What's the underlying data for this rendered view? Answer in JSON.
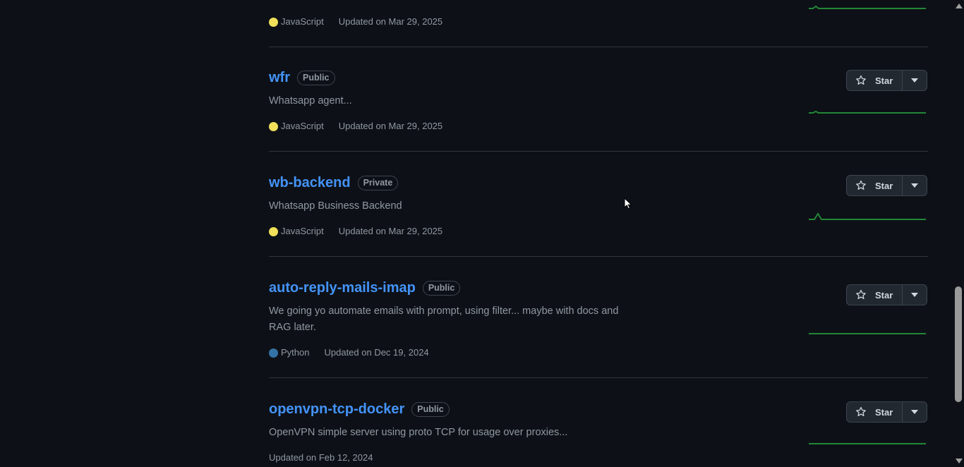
{
  "star_label": "Star",
  "repos": [
    {
      "name": "",
      "visibility": "",
      "description": "",
      "language": "JavaScript",
      "language_color": "#f1e05a",
      "updated": "Updated on Mar 29, 2025"
    },
    {
      "name": "wfr",
      "visibility": "Public",
      "description": "Whatsapp agent...",
      "language": "JavaScript",
      "language_color": "#f1e05a",
      "updated": "Updated on Mar 29, 2025"
    },
    {
      "name": "wb-backend",
      "visibility": "Private",
      "description": "Whatsapp Business Backend",
      "language": "JavaScript",
      "language_color": "#f1e05a",
      "updated": "Updated on Mar 29, 2025"
    },
    {
      "name": "auto-reply-mails-imap",
      "visibility": "Public",
      "description": "We going yo automate emails with prompt, using filter... maybe with docs and RAG later.",
      "language": "Python",
      "language_color": "#3572A5",
      "updated": "Updated on Dec 19, 2024"
    },
    {
      "name": "openvpn-tcp-docker",
      "visibility": "Public",
      "description": "OpenVPN simple server using proto TCP for usage over proxies...",
      "language": "",
      "language_color": "",
      "updated": "Updated on Feb 12, 2024"
    }
  ],
  "colors": {
    "background": "#0d1117",
    "link": "#4493f8",
    "muted": "#9198a1",
    "border": "#30363d",
    "sparkline": "#238636"
  }
}
